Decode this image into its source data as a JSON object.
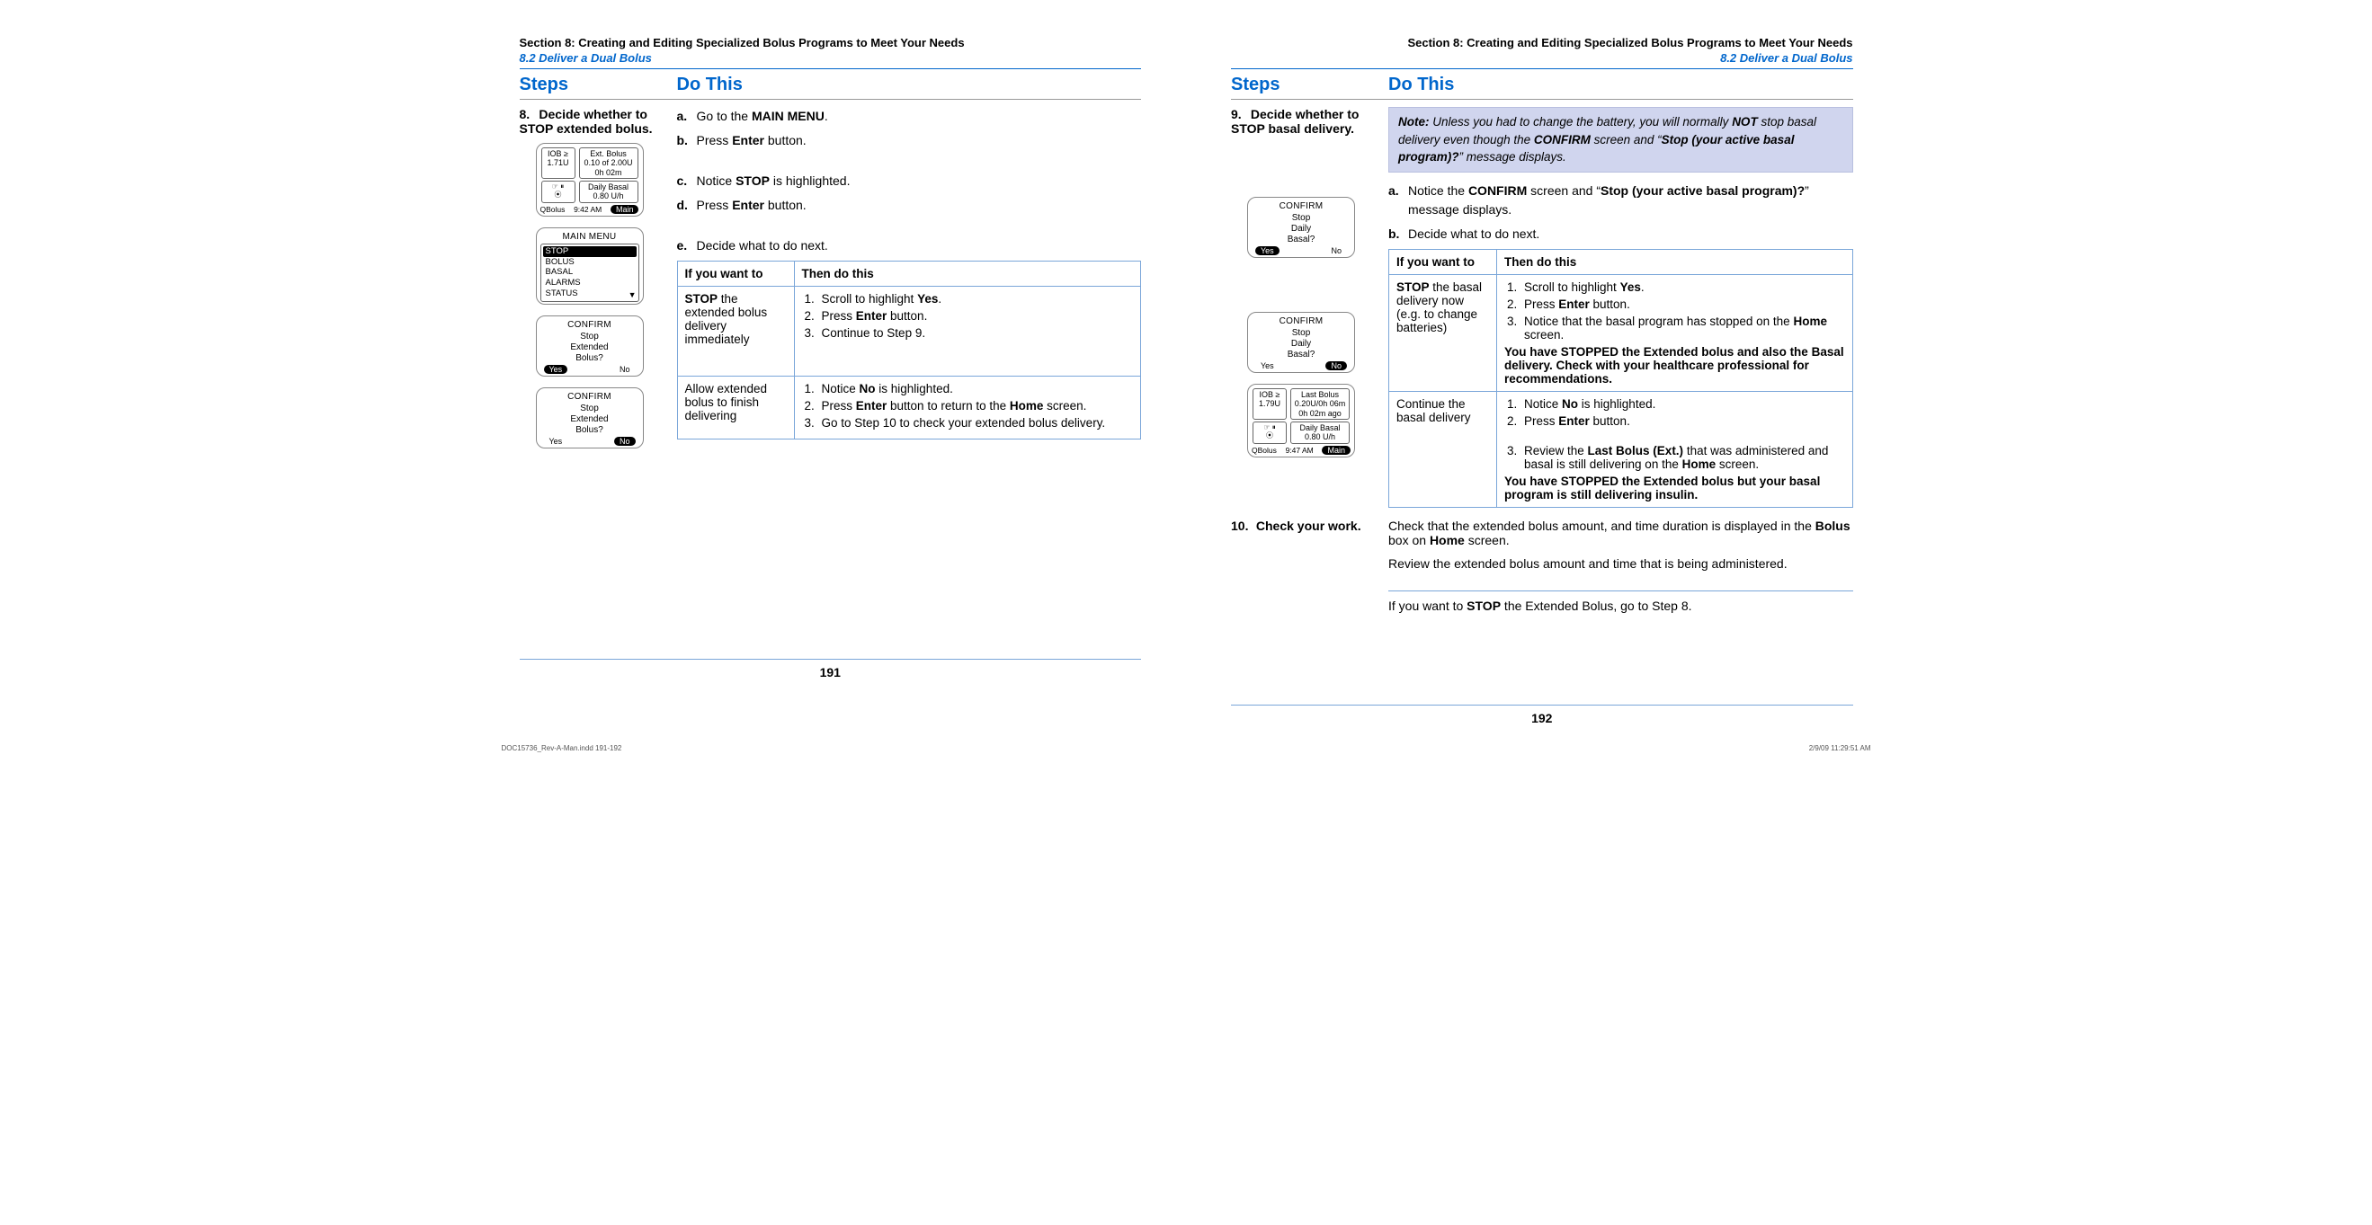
{
  "header": {
    "section": "Section 8: Creating and Editing Specialized Bolus Programs to Meet Your Needs",
    "subsection": "8.2 Deliver a Dual Bolus"
  },
  "columns": {
    "steps": "Steps",
    "do": "Do This"
  },
  "left": {
    "step8": {
      "num": "8.",
      "title": "Decide whether to STOP extended bolus.",
      "a_letter": "a.",
      "a_pre": "Go to the ",
      "a_bold": "MAIN MENU",
      "a_post": ".",
      "b_letter": "b.",
      "b_pre": "Press ",
      "b_bold": "Enter",
      "b_post": " button.",
      "c_letter": "c.",
      "c_pre": "Notice ",
      "c_bold": "STOP",
      "c_post": " is highlighted.",
      "d_letter": "d.",
      "d_pre": "Press ",
      "d_bold": "Enter",
      "d_post": " button.",
      "e_letter": "e.",
      "e_text": "Decide what to do next.",
      "table": {
        "h1": "If you want to",
        "h2": "Then do this",
        "r1_wp": "STOP",
        "r1_want": " the extended bolus delivery immediately",
        "r1_1a": "Scroll to highlight ",
        "r1_1b": "Yes",
        "r1_1c": ".",
        "r1_2a": "Press ",
        "r1_2b": "Enter",
        "r1_2c": " button.",
        "r1_3": "Continue to Step 9.",
        "r2_want": "Allow extended bolus to finish delivering",
        "r2_1a": "Notice ",
        "r2_1b": "No",
        "r2_1c": " is highlighted.",
        "r2_2a": "Press ",
        "r2_2b": "Enter",
        "r2_2c": " button to return to the ",
        "r2_2d": "Home",
        "r2_2e": " screen.",
        "r2_3": "Go to Step 10 to check your extended bolus delivery."
      }
    },
    "dev1": {
      "iob_lbl": "IOB ≥",
      "iob_val": "1.71U",
      "ext_l1": "Ext. Bolus",
      "ext_l2": "0.10 of 2.00U",
      "ext_l3": "0h 02m",
      "basal_l1": "Daily Basal",
      "basal_l2": "0.80 U/h",
      "foot_l": "QBolus",
      "foot_c": "9:42 AM",
      "foot_r": "Main"
    },
    "dev2": {
      "title": "MAIN MENU",
      "i1": "STOP",
      "i2": "BOLUS",
      "i3": "BASAL",
      "i4": "ALARMS",
      "i5": "STATUS"
    },
    "dev3": {
      "title": "CONFIRM",
      "l1": "Stop",
      "l2": "Extended",
      "l3": "Bolus?",
      "yes": "Yes",
      "no": "No"
    },
    "dev4": {
      "title": "CONFIRM",
      "l1": "Stop",
      "l2": "Extended",
      "l3": "Bolus?",
      "yes": "Yes",
      "no": "No"
    },
    "page_num": "191",
    "slug": "DOC15736_Rev-A-Man.indd   191-192"
  },
  "right": {
    "step9": {
      "num": "9.",
      "title": "Decide whether to STOP basal delivery.",
      "note_lead": "Note:",
      "note_1": " Unless you had to change the battery, you will normally ",
      "note_not": "NOT",
      "note_2": " stop basal delivery even though the ",
      "note_conf": "CONFIRM",
      "note_3": " screen and “",
      "note_stop": "Stop (your active basal program)?",
      "note_4": "” message displays.",
      "a_letter": "a.",
      "a_1": "Notice the ",
      "a_b1": "CONFIRM",
      "a_2": " screen and “",
      "a_b2": "Stop (your active basal program)?",
      "a_3": "” message displays.",
      "b_letter": "b.",
      "b_text": "Decide what to do next.",
      "table": {
        "h1": "If you want to",
        "h2": "Then do this",
        "r1_wp": "STOP",
        "r1_want": " the basal delivery now (e.g. to change batteries)",
        "r1_1a": "Scroll to highlight ",
        "r1_1b": "Yes",
        "r1_1c": ".",
        "r1_2a": "Press ",
        "r1_2b": "Enter",
        "r1_2c": " button.",
        "r1_3a": "Notice that the basal program has stopped on the ",
        "r1_3b": "Home",
        "r1_3c": " screen.",
        "r1_tail": "You have STOPPED the Extended bolus and also the Basal delivery. Check with your healthcare professional for recommendations.",
        "r2_want": "Continue the basal delivery",
        "r2_1a": "Notice ",
        "r2_1b": "No",
        "r2_1c": " is highlighted.",
        "r2_2a": "Press ",
        "r2_2b": "Enter",
        "r2_2c": " button.",
        "r2_3a": "Review the ",
        "r2_3b": "Last Bolus (Ext.)",
        "r2_3c": " that was administered and basal is still delivering on the ",
        "r2_3d": "Home",
        "r2_3e": " screen.",
        "r2_tail": "You have STOPPED the Extended bolus but your basal program is still delivering insulin."
      }
    },
    "dev1": {
      "title": "CONFIRM",
      "l1": "Stop",
      "l2": "Daily",
      "l3": "Basal?",
      "yes": "Yes",
      "no": "No"
    },
    "dev2": {
      "title": "CONFIRM",
      "l1": "Stop",
      "l2": "Daily",
      "l3": "Basal?",
      "yes": "Yes",
      "no": "No"
    },
    "dev3": {
      "iob_lbl": "IOB ≥",
      "iob_val": "1.79U",
      "last_l1": "Last Bolus",
      "last_l2": "0.20U/0h 06m",
      "last_l3": "0h 02m ago",
      "basal_l1": "Daily Basal",
      "basal_l2": "0.80 U/h",
      "foot_l": "QBolus",
      "foot_c": "9:47 AM",
      "foot_r": "Main"
    },
    "step10": {
      "num": "10.",
      "title": "Check your work.",
      "p1a": "Check that the extended bolus amount, and time duration is displayed in the ",
      "p1b": "Bolus",
      "p1c": " box on ",
      "p1d": "Home",
      "p1e": " screen.",
      "p2": "Review the extended bolus amount and time that is being administered.",
      "p3a": "If you want to ",
      "p3b": "STOP",
      "p3c": " the Extended Bolus, go to Step 8."
    },
    "page_num": "192",
    "slug": "2/9/09   11:29:51 AM"
  }
}
